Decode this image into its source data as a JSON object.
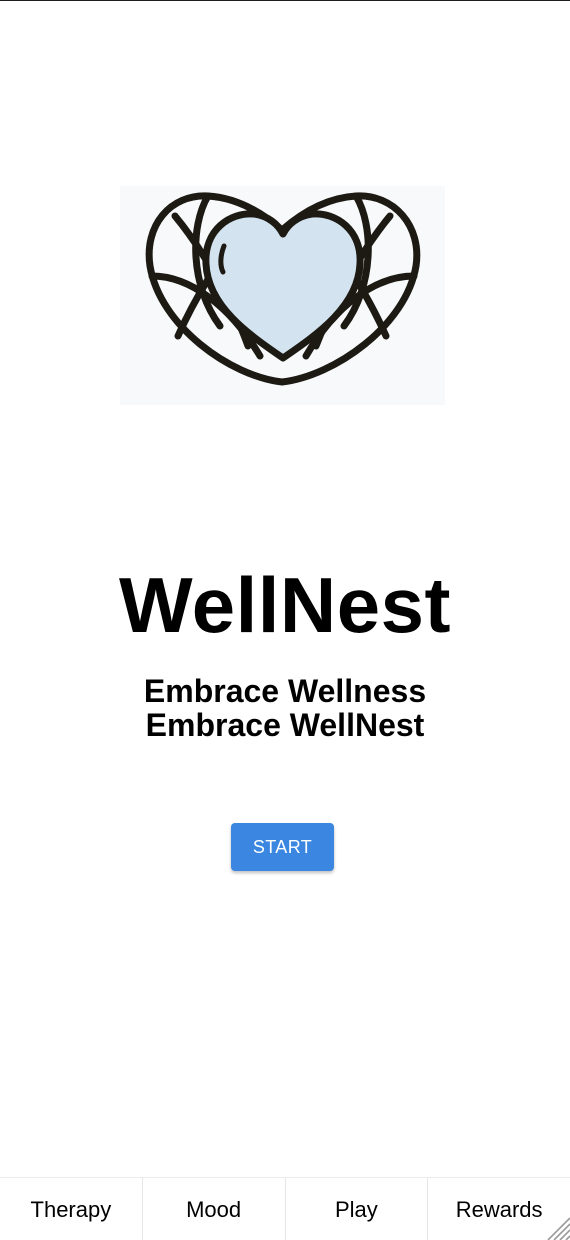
{
  "app": {
    "title": "WellNest",
    "tagline_line1": "Embrace Wellness",
    "tagline_line2": "Embrace WellNest",
    "logo_icon": "heart-nest-logo",
    "logo_heart_fill": "#d3e3f0",
    "logo_stroke": "#1c1a12"
  },
  "start": {
    "label": "START",
    "color": "#3b86e0"
  },
  "bottom_nav": {
    "items": [
      {
        "label": "Therapy"
      },
      {
        "label": "Mood"
      },
      {
        "label": "Play"
      },
      {
        "label": "Rewards"
      }
    ]
  }
}
